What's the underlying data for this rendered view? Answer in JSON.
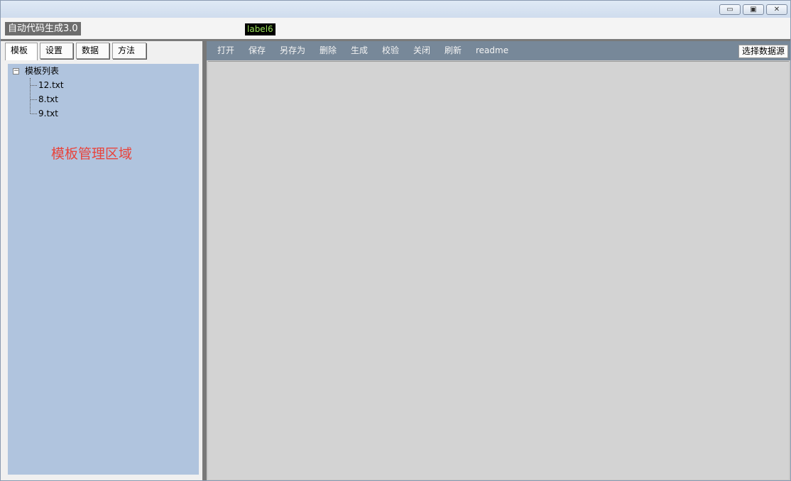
{
  "window": {
    "controls": {
      "minimize": "▭",
      "maximize": "▣",
      "close": "✕"
    }
  },
  "header": {
    "app_title": "自动代码生成3.0",
    "status_label": "label6"
  },
  "tabs": [
    {
      "label": "模板",
      "active": true
    },
    {
      "label": "设置",
      "active": false
    },
    {
      "label": "数据",
      "active": false
    },
    {
      "label": "方法",
      "active": false
    }
  ],
  "tree": {
    "root_label": "模板列表",
    "expander": "−",
    "items": [
      "12.txt",
      "8.txt",
      "9.txt"
    ]
  },
  "left_area_label": "模板管理区域",
  "toolbar": {
    "items": [
      "打开",
      "保存",
      "另存为",
      "删除",
      "生成",
      "校验",
      "关闭",
      "刷新",
      "readme"
    ],
    "select_source_button": "选择数据源"
  },
  "colors": {
    "tree_background": "#b0c4de",
    "toolbar_background": "#778899",
    "editor_background": "#d3d3d3",
    "area_label_color": "#e8443c"
  }
}
